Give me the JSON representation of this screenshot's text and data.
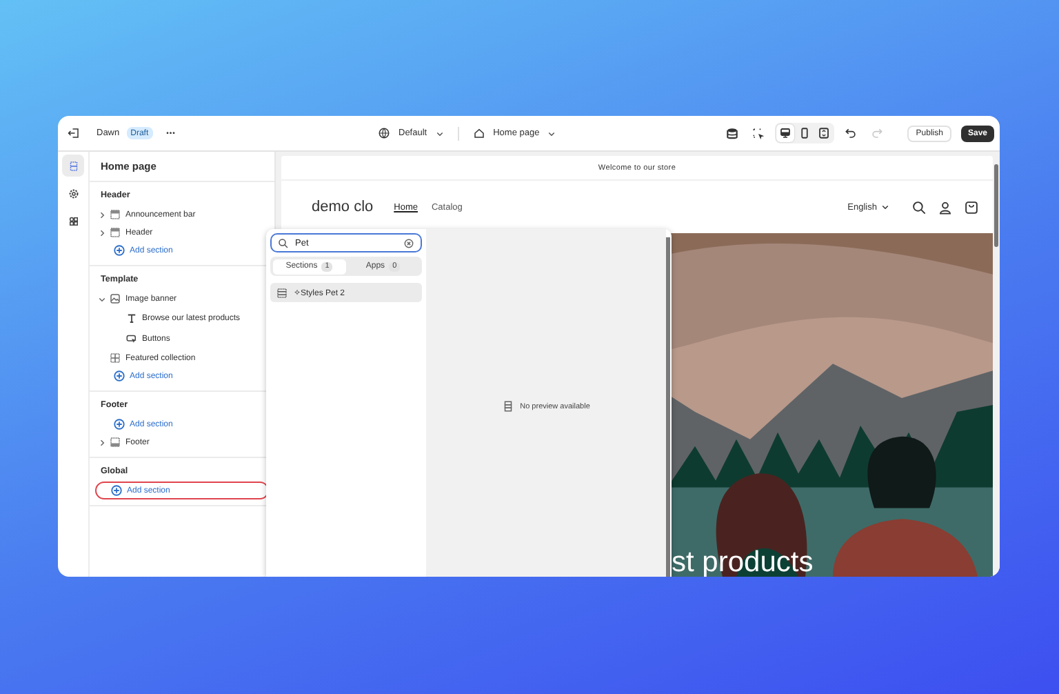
{
  "topbar": {
    "theme_name": "Dawn",
    "status_badge": "Draft",
    "more": "•••",
    "theme_selector": "Default",
    "page_selector": "Home page",
    "view_modes": [
      {
        "kind": "desktop",
        "selected": true
      },
      {
        "kind": "mobile",
        "selected": false
      },
      {
        "kind": "fullscreen",
        "selected": false
      }
    ],
    "redo": {
      "disabled": true
    },
    "publish": "Publish",
    "save": "Save"
  },
  "rail": [
    {
      "kind": "sections",
      "selected": true
    },
    {
      "kind": "settings",
      "selected": false
    },
    {
      "kind": "apps",
      "selected": false
    }
  ],
  "sidebar": {
    "title": "Home page",
    "groups": [
      {
        "title": "Header",
        "entries": [
          {
            "kind": "bar",
            "label": "Announcement bar",
            "expanded": false
          },
          {
            "kind": "header",
            "label": "Header",
            "expanded": false
          },
          {
            "kind": "add",
            "label": "Add section",
            "highlighted": false
          }
        ]
      },
      {
        "title": "Template",
        "entries": [
          {
            "kind": "image",
            "label": "Image banner",
            "expanded": true,
            "children": [
              {
                "kind": "text",
                "label": "Browse our latest products"
              },
              {
                "kind": "button",
                "label": "Buttons"
              }
            ]
          },
          {
            "kind": "grid",
            "label": "Featured collection"
          },
          {
            "kind": "add",
            "label": "Add section",
            "highlighted": false
          }
        ]
      },
      {
        "title": "Footer",
        "entries": [
          {
            "kind": "add",
            "label": "Add section",
            "highlighted": false
          },
          {
            "kind": "footer",
            "label": "Footer",
            "expanded": false
          }
        ]
      },
      {
        "title": "Global",
        "entries": [
          {
            "kind": "add",
            "label": "Add section",
            "highlighted": true
          }
        ]
      }
    ]
  },
  "store": {
    "announcement": "Welcome to our store",
    "logo": "demo clo",
    "nav": [
      {
        "label": "Home",
        "selected": true
      },
      {
        "label": "Catalog",
        "selected": false
      }
    ],
    "language": "English",
    "hero_heading": "st products"
  },
  "picker": {
    "search": {
      "value": "Pet"
    },
    "tabs": [
      {
        "label": "Sections",
        "count": "1",
        "selected": true
      },
      {
        "label": "Apps",
        "count": "0",
        "selected": false
      }
    ],
    "results": [
      {
        "label": "✧Styles Pet 2",
        "selected": false
      }
    ],
    "preview_message": "No preview available"
  }
}
